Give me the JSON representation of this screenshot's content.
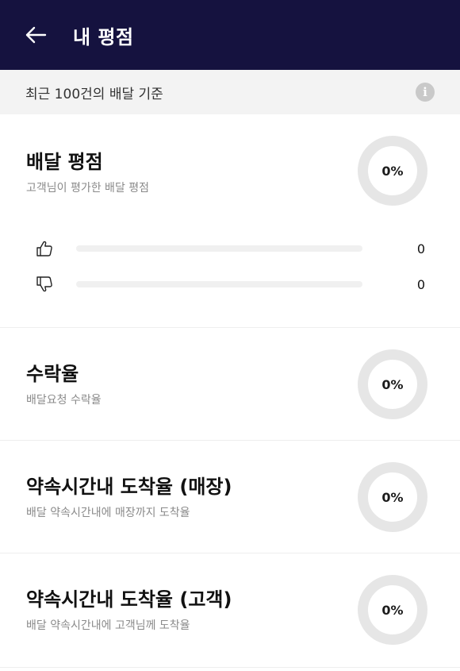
{
  "header": {
    "title": "내 평점",
    "back_icon": "arrow-left-icon"
  },
  "info_bar": {
    "text": "최근 100건의 배달 기준",
    "icon": "info-icon",
    "icon_glyph": "i"
  },
  "sections": {
    "delivery_rating": {
      "title": "배달 평점",
      "subtitle": "고객님이 평가한 배달 평점",
      "percent_text": "0%",
      "percent": 0,
      "thumbs_up": {
        "icon": "thumbs-up-icon",
        "count": "0",
        "fraction": 0
      },
      "thumbs_down": {
        "icon": "thumbs-down-icon",
        "count": "0",
        "fraction": 0
      }
    },
    "acceptance_rate": {
      "title": "수락율",
      "subtitle": "배달요청 수락율",
      "percent_text": "0%",
      "percent": 0
    },
    "on_time_store": {
      "title": "약속시간내 도착율 (매장)",
      "subtitle": "배달 약속시간내에 매장까지 도착율",
      "percent_text": "0%",
      "percent": 0
    },
    "on_time_customer": {
      "title": "약속시간내 도착율 (고객)",
      "subtitle": "배달 약속시간내에 고객님께 도착율",
      "percent_text": "0%",
      "percent": 0
    }
  },
  "colors": {
    "header_bg": "#15123f",
    "info_bg": "#f3f3f3",
    "ring_track": "#e6e6e6",
    "bar_track": "#f0f0f0"
  }
}
